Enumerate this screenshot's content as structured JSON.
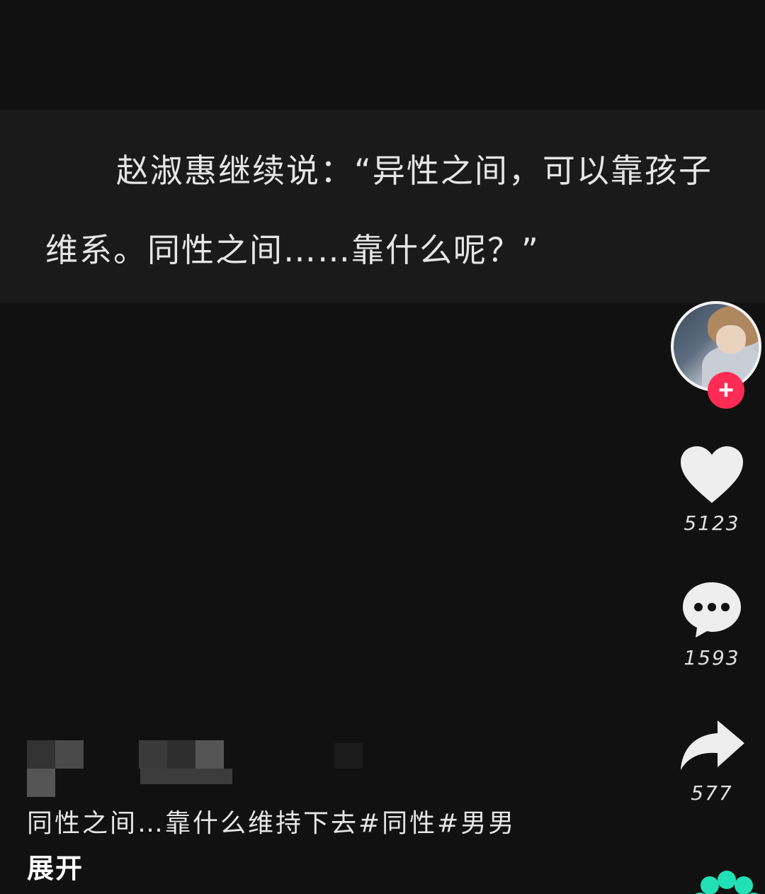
{
  "subtitle": {
    "text": "赵淑惠继续说：“异性之间，可以靠孩子维系。同性之间……靠什么呢？”"
  },
  "actions": {
    "likes": "5123",
    "comments": "1593",
    "shares": "577"
  },
  "icons": {
    "follow": "plus-icon",
    "like": "heart-icon",
    "comment": "comment-bubble-icon",
    "share": "share-arrow-icon",
    "music": "music-disc-icon"
  },
  "colors": {
    "background": "#111111",
    "follow_button": "#fe2c55",
    "music_accent": "#22e0b5"
  },
  "caption": {
    "text": "同性之间…靠什么维持下去#同性#男男",
    "expand_label": "展开"
  }
}
